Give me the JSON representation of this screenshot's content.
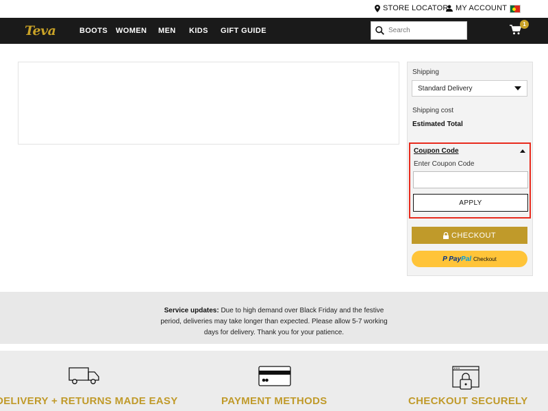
{
  "utility": {
    "store_locator": "STORE LOCATOR",
    "my_account": "MY ACCOUNT"
  },
  "nav": {
    "logo": "Teva",
    "links": [
      "BOOTS",
      "WOMEN",
      "MEN",
      "KIDS",
      "GIFT GUIDE"
    ],
    "search_placeholder": "Search",
    "cart_count": "1"
  },
  "summary": {
    "shipping_label": "Shipping",
    "shipping_selected": "Standard Delivery",
    "shipping_cost_label": "Shipping cost",
    "estimated_total_label": "Estimated Total",
    "coupon": {
      "title": "Coupon Code",
      "hint": "Enter Coupon Code",
      "input_value": "",
      "apply_label": "APPLY"
    },
    "checkout_label": "CHECKOUT",
    "paypal": {
      "pay": "Pay",
      "pal": "Pal",
      "checkout": "Checkout"
    }
  },
  "service": {
    "label": "Service updates:",
    "text": " Due to high demand over Black Friday and the festive period, deliveries may take longer than expected. Please allow 5-7 working days for delivery. Thank you for your patience."
  },
  "features": [
    {
      "title": "DELIVERY + RETURNS MADE EASY",
      "icon": "truck-icon"
    },
    {
      "title": "PAYMENT METHODS",
      "icon": "credit-card-icon"
    },
    {
      "title": "CHECKOUT SECURELY",
      "icon": "secure-lock-icon"
    }
  ],
  "colors": {
    "gold": "#c09a2a",
    "nav_bg": "#1a1a1a",
    "highlight_red": "#e8291c",
    "paypal_yellow": "#ffc439"
  }
}
